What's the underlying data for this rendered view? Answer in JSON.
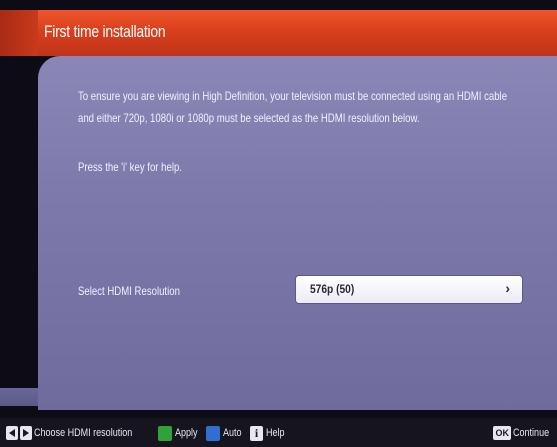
{
  "header": {
    "title": "First time installation",
    "color": "#d83f1c"
  },
  "content": {
    "info_line_1": "To ensure you are viewing in High Definition, your television must be connected using an HDMI cable",
    "info_line_2": "and either 720p, 1080i or 1080p must be selected as the HDMI resolution below.",
    "help_text": "Press the 'i' key for help."
  },
  "setting": {
    "label": "Select HDMI Resolution",
    "value": "576p (50)"
  },
  "footer": {
    "choose_label": "Choose HDMI resolution",
    "apply_label": "Apply",
    "auto_label": "Auto",
    "info_key_glyph": "i",
    "help_label": "Help",
    "ok_key_label": "OK",
    "continue_label": "Continue",
    "apply_color": "#2fa33a",
    "auto_color": "#2f6fd1"
  }
}
